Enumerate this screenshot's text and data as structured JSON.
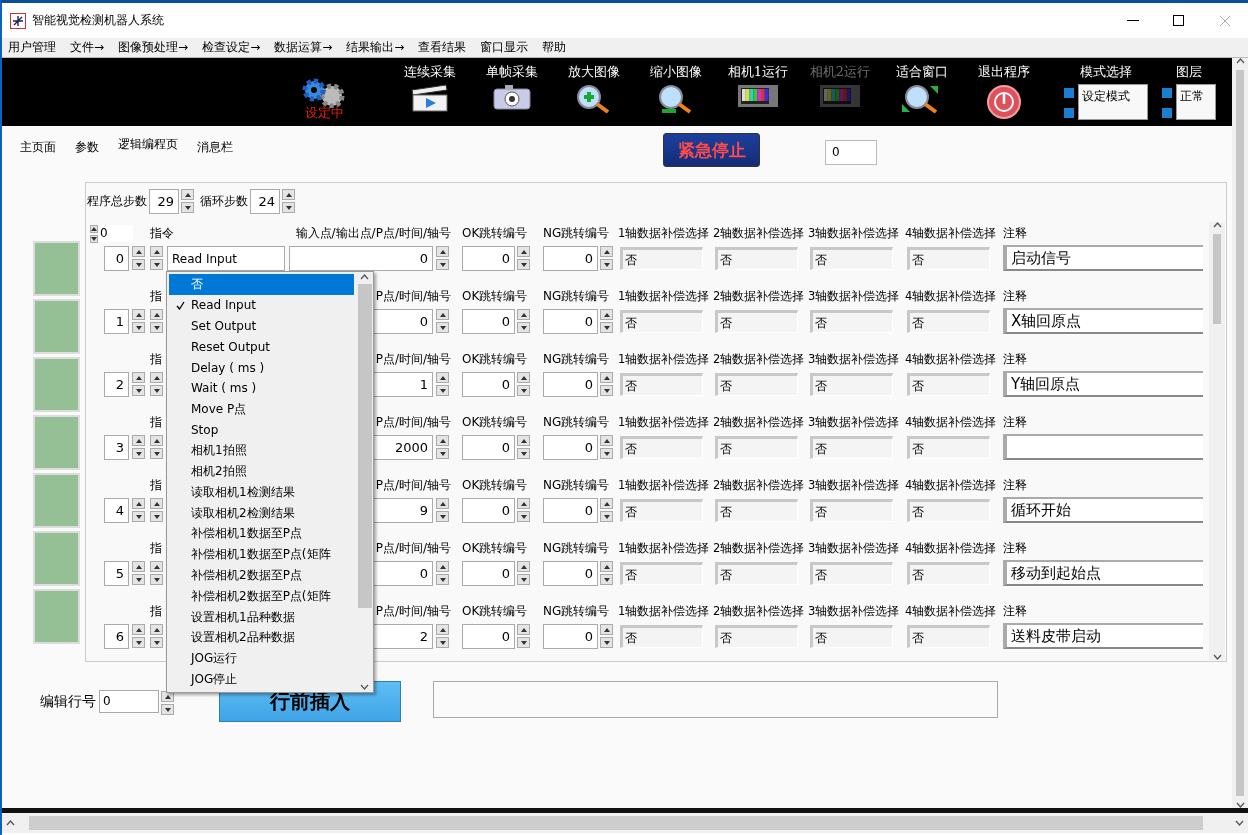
{
  "window": {
    "title": "智能视觉检测机器人系统"
  },
  "menu": [
    "用户管理",
    "文件→",
    "图像预处理→",
    "检查设定→",
    "数据运算→",
    "结果输出→",
    "查看结果",
    "窗口显示",
    "帮助"
  ],
  "toolbar": {
    "status": "设定中",
    "buttons": [
      {
        "label": "连续采集",
        "kind": "clapper",
        "disabled": false
      },
      {
        "label": "单帧采集",
        "kind": "camera",
        "disabled": false
      },
      {
        "label": "放大图像",
        "kind": "zoom-in",
        "disabled": false
      },
      {
        "label": "缩小图像",
        "kind": "zoom-out",
        "disabled": false
      },
      {
        "label": "相机1运行",
        "kind": "tv",
        "disabled": false
      },
      {
        "label": "相机2运行",
        "kind": "tv",
        "disabled": true
      },
      {
        "label": "适合窗口",
        "kind": "fit",
        "disabled": false
      },
      {
        "label": "退出程序",
        "kind": "power",
        "disabled": false
      }
    ],
    "mode_select": {
      "label": "模式选择",
      "value": "设定模式"
    },
    "layer_select": {
      "label": "图层",
      "value": "正常"
    }
  },
  "page_tabs": [
    {
      "label": "主页面",
      "selected": false
    },
    {
      "label": "参数",
      "selected": false
    },
    {
      "label": "逻辑编程页",
      "selected": true
    },
    {
      "label": "消息栏",
      "selected": false
    }
  ],
  "emergency_stop": "紧急停止",
  "counter": "0",
  "program": {
    "total_steps_label": "程序总步数",
    "total_steps": "29",
    "loop_steps_label": "循环步数",
    "loop_steps": "24",
    "scroll_index": "0",
    "rows": [
      {
        "number": "0",
        "instruction_label": "指令",
        "instruction": "Read Input",
        "io_label": "输入点/输出点/P点/时间/轴号",
        "io": "0",
        "ok_label": "OK跳转编号",
        "ok": "0",
        "ng_label": "NG跳转编号",
        "ng": "0",
        "comp": [
          {
            "label": "1轴数据补偿选择",
            "value": "否"
          },
          {
            "label": "2轴数据补偿选择",
            "value": "否"
          },
          {
            "label": "3轴数据补偿选择",
            "value": "否"
          },
          {
            "label": "4轴数据补偿选择",
            "value": "否"
          }
        ],
        "comment_label": "注释",
        "comment": "启动信号"
      },
      {
        "number": "1",
        "instruction_label": "指",
        "io_label": "P点/时间/轴号",
        "io": "0",
        "ok_label": "OK跳转编号",
        "ok": "0",
        "ng_label": "NG跳转编号",
        "ng": "0",
        "comp": [
          {
            "label": "1轴数据补偿选择",
            "value": "否"
          },
          {
            "label": "2轴数据补偿选择",
            "value": "否"
          },
          {
            "label": "3轴数据补偿选择",
            "value": "否"
          },
          {
            "label": "4轴数据补偿选择",
            "value": "否"
          }
        ],
        "comment_label": "注释",
        "comment": "X轴回原点"
      },
      {
        "number": "2",
        "instruction_label": "指",
        "io_label": "P点/时间/轴号",
        "io": "1",
        "ok_label": "OK跳转编号",
        "ok": "0",
        "ng_label": "NG跳转编号",
        "ng": "0",
        "comp": [
          {
            "label": "1轴数据补偿选择",
            "value": "否"
          },
          {
            "label": "2轴数据补偿选择",
            "value": "否"
          },
          {
            "label": "3轴数据补偿选择",
            "value": "否"
          },
          {
            "label": "4轴数据补偿选择",
            "value": "否"
          }
        ],
        "comment_label": "注释",
        "comment": "Y轴回原点"
      },
      {
        "number": "3",
        "instruction_label": "指",
        "io_label": "P点/时间/轴号",
        "io": "2000",
        "ok_label": "OK跳转编号",
        "ok": "0",
        "ng_label": "NG跳转编号",
        "ng": "0",
        "comp": [
          {
            "label": "1轴数据补偿选择",
            "value": "否"
          },
          {
            "label": "2轴数据补偿选择",
            "value": "否"
          },
          {
            "label": "3轴数据补偿选择",
            "value": "否"
          },
          {
            "label": "4轴数据补偿选择",
            "value": "否"
          }
        ],
        "comment_label": "注释"
      },
      {
        "number": "4",
        "instruction_label": "指",
        "io_label": "P点/时间/轴号",
        "io": "9",
        "ok_label": "OK跳转编号",
        "ok": "0",
        "ng_label": "NG跳转编号",
        "ng": "0",
        "comp": [
          {
            "label": "1轴数据补偿选择",
            "value": "否"
          },
          {
            "label": "2轴数据补偿选择",
            "value": "否"
          },
          {
            "label": "3轴数据补偿选择",
            "value": "否"
          },
          {
            "label": "4轴数据补偿选择",
            "value": "否"
          }
        ],
        "comment_label": "注释",
        "comment": "循环开始"
      },
      {
        "number": "5",
        "instruction_label": "指",
        "io_label": "P点/时间/轴号",
        "io": "0",
        "ok_label": "OK跳转编号",
        "ok": "0",
        "ng_label": "NG跳转编号",
        "ng": "0",
        "comp": [
          {
            "label": "1轴数据补偿选择",
            "value": "否"
          },
          {
            "label": "2轴数据补偿选择",
            "value": "否"
          },
          {
            "label": "3轴数据补偿选择",
            "value": "否"
          },
          {
            "label": "4轴数据补偿选择",
            "value": "否"
          }
        ],
        "comment_label": "注释",
        "comment": "移动到起始点"
      },
      {
        "number": "6",
        "instruction_label": "指",
        "io_label": "P点/时间/轴号",
        "io": "2",
        "ok_label": "OK跳转编号",
        "ok": "0",
        "ng_label": "NG跳转编号",
        "ng": "0",
        "comp": [
          {
            "label": "1轴数据补偿选择",
            "value": "否"
          },
          {
            "label": "2轴数据补偿选择",
            "value": "否"
          },
          {
            "label": "3轴数据补偿选择",
            "value": "否"
          },
          {
            "label": "4轴数据补偿选择",
            "value": "否"
          }
        ],
        "comment_label": "注释",
        "comment": "送料皮带启动"
      }
    ]
  },
  "instruction_dropdown": {
    "items": [
      {
        "label": "否",
        "selected": true,
        "checked": false
      },
      {
        "label": "Read Input",
        "selected": false,
        "checked": true
      },
      {
        "label": "Set Output",
        "selected": false,
        "checked": false
      },
      {
        "label": "Reset Output",
        "selected": false,
        "checked": false
      },
      {
        "label": "Delay ( ms )",
        "selected": false,
        "checked": false
      },
      {
        "label": "Wait ( ms )",
        "selected": false,
        "checked": false
      },
      {
        "label": "Move P点",
        "selected": false,
        "checked": false
      },
      {
        "label": "Stop",
        "selected": false,
        "checked": false
      },
      {
        "label": "相机1拍照",
        "selected": false,
        "checked": false
      },
      {
        "label": "相机2拍照",
        "selected": false,
        "checked": false
      },
      {
        "label": "读取相机1检测结果",
        "selected": false,
        "checked": false
      },
      {
        "label": "读取相机2检测结果",
        "selected": false,
        "checked": false
      },
      {
        "label": "补偿相机1数据至P点",
        "selected": false,
        "checked": false
      },
      {
        "label": "补偿相机1数据至P点(矩阵",
        "selected": false,
        "checked": false
      },
      {
        "label": "补偿相机2数据至P点",
        "selected": false,
        "checked": false
      },
      {
        "label": "补偿相机2数据至P点(矩阵",
        "selected": false,
        "checked": false
      },
      {
        "label": "设置相机1品种数据",
        "selected": false,
        "checked": false
      },
      {
        "label": "设置相机2品种数据",
        "selected": false,
        "checked": false
      },
      {
        "label": "JOG运行",
        "selected": false,
        "checked": false
      },
      {
        "label": "JOG停止",
        "selected": false,
        "checked": false
      }
    ]
  },
  "editor": {
    "edit_row_label": "编辑行号",
    "edit_row": "0",
    "insert_button": "行前插入"
  }
}
